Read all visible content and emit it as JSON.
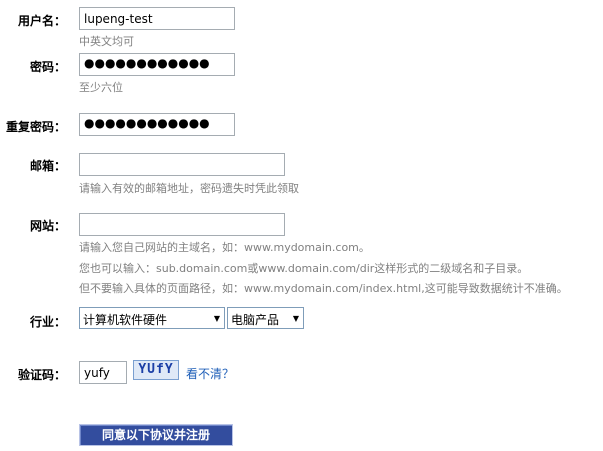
{
  "form": {
    "username": {
      "label": "用户名：",
      "value": "lupeng-test",
      "hint": "中英文均可"
    },
    "password": {
      "label": "密码：",
      "value": "●●●●●●●●●●●●",
      "hint": "至少六位"
    },
    "password_repeat": {
      "label": "重复密码：",
      "value": "●●●●●●●●●●●●"
    },
    "email": {
      "label": "邮箱：",
      "value": "",
      "hint": "请输入有效的邮箱地址，密码遗失时凭此领取"
    },
    "website": {
      "label": "网站：",
      "value": "",
      "hints": [
        "请输入您自己网站的主域名，如：www.mydomain.com。",
        "您也可以输入：sub.domain.com或www.domain.com/dir这样形式的二级域名和子目录。",
        "但不要输入具体的页面路径，如：www.mydomain.com/index.html,这可能导致数据统计不准确。"
      ]
    },
    "industry": {
      "label": "行业：",
      "primary": "计算机软件硬件",
      "secondary": "电脑产品"
    },
    "captcha": {
      "label": "验证码：",
      "value": "yufy",
      "image_text": "YUfY",
      "refresh_link": "看不清？"
    },
    "submit_label": "同意以下协议并注册"
  }
}
